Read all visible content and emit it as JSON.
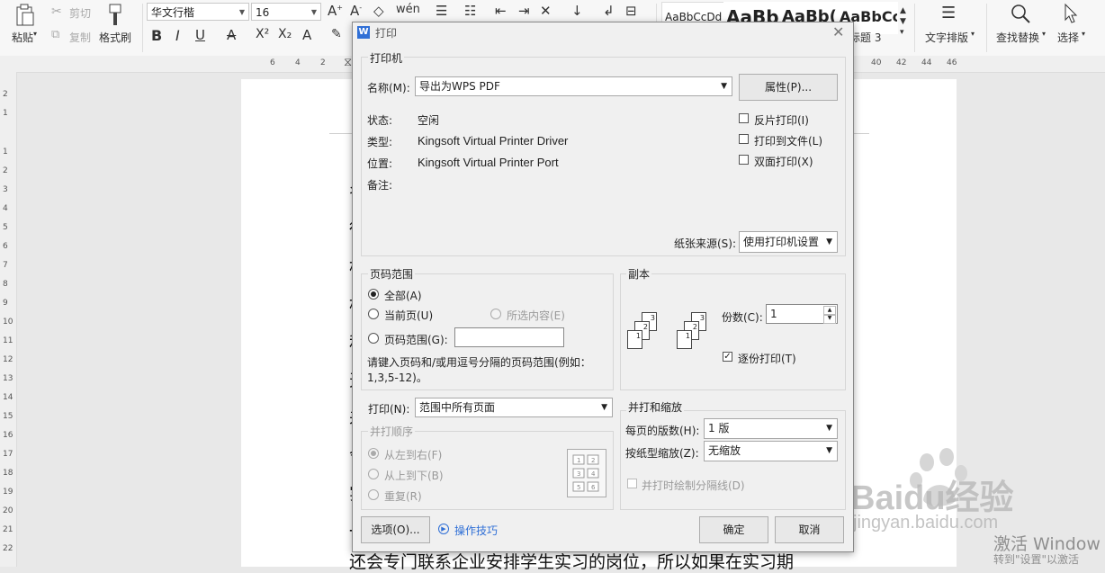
{
  "ribbon": {
    "paste": "粘贴",
    "cut": "剪切",
    "copy": "复制",
    "format_painter": "格式刷",
    "font_name": "华文行楷",
    "font_size": "16",
    "style_previews": [
      "AaBbCcDd",
      "AaBb",
      "AaBb(",
      "AaBbCc"
    ],
    "heading3": "标题 3",
    "text_layout": "文字排版",
    "find_replace": "查找替换",
    "select": "选择"
  },
  "ruler": {
    "h_left": [
      "6",
      "4",
      "2"
    ],
    "h_right": [
      "40",
      "42",
      "44",
      "46"
    ],
    "v": [
      "2",
      "1",
      "1",
      "2",
      "3",
      "4",
      "5",
      "6",
      "7",
      "8",
      "9",
      "10",
      "11",
      "12",
      "13",
      "14",
      "15",
      "16",
      "17",
      "18",
      "19",
      "20",
      "21",
      "22"
    ]
  },
  "document": {
    "bottom_line": "还会专门联系企业安排学生实习的岗位，所以如果在实习期",
    "margin_chars": [
      "名",
      "徐",
      "松",
      "松",
      "和",
      "天",
      "差",
      "舍",
      "实",
      "一"
    ]
  },
  "watermark": {
    "brand": "Baidu经验",
    "url": "jingyan.baidu.com",
    "activate": "激活 Window",
    "activate_sub": "转到\"设置\"以激活"
  },
  "dialog": {
    "title": "打印",
    "printer": {
      "group": "打印机",
      "name_label": "名称(M):",
      "name_value": "导出为WPS PDF",
      "properties": "属性(P)...",
      "status_label": "状态:",
      "status_value": "空闲",
      "type_label": "类型:",
      "type_value": "Kingsoft Virtual Printer Driver",
      "location_label": "位置:",
      "location_value": "Kingsoft Virtual Printer Port",
      "comment_label": "备注:",
      "reverse": "反片打印(I)",
      "to_file": "打印到文件(L)",
      "duplex": "双面打印(X)",
      "source_label": "纸张来源(S):",
      "source_value": "使用打印机设置"
    },
    "range": {
      "group": "页码范围",
      "all": "全部(A)",
      "current": "当前页(U)",
      "selection": "所选内容(E)",
      "pages": "页码范围(G):",
      "hint": "请键入页码和/或用逗号分隔的页码范围(例如：1,3,5-12)。"
    },
    "copies": {
      "group": "副本",
      "count_label": "份数(C):",
      "count_value": "1",
      "collate": "逐份打印(T)"
    },
    "print_what": {
      "label": "打印(N):",
      "value": "范围中所有页面"
    },
    "order": {
      "group": "并打顺序",
      "ltr": "从左到右(F)",
      "ttb": "从上到下(B)",
      "repeat": "重复(R)"
    },
    "scale": {
      "group": "并打和缩放",
      "per_sheet_label": "每页的版数(H):",
      "per_sheet_value": "1 版",
      "scale_label": "按纸型缩放(Z):",
      "scale_value": "无缩放",
      "draw_lines": "并打时绘制分隔线(D)"
    },
    "options": "选项(O)...",
    "tips": "操作技巧",
    "ok": "确定",
    "cancel": "取消"
  }
}
